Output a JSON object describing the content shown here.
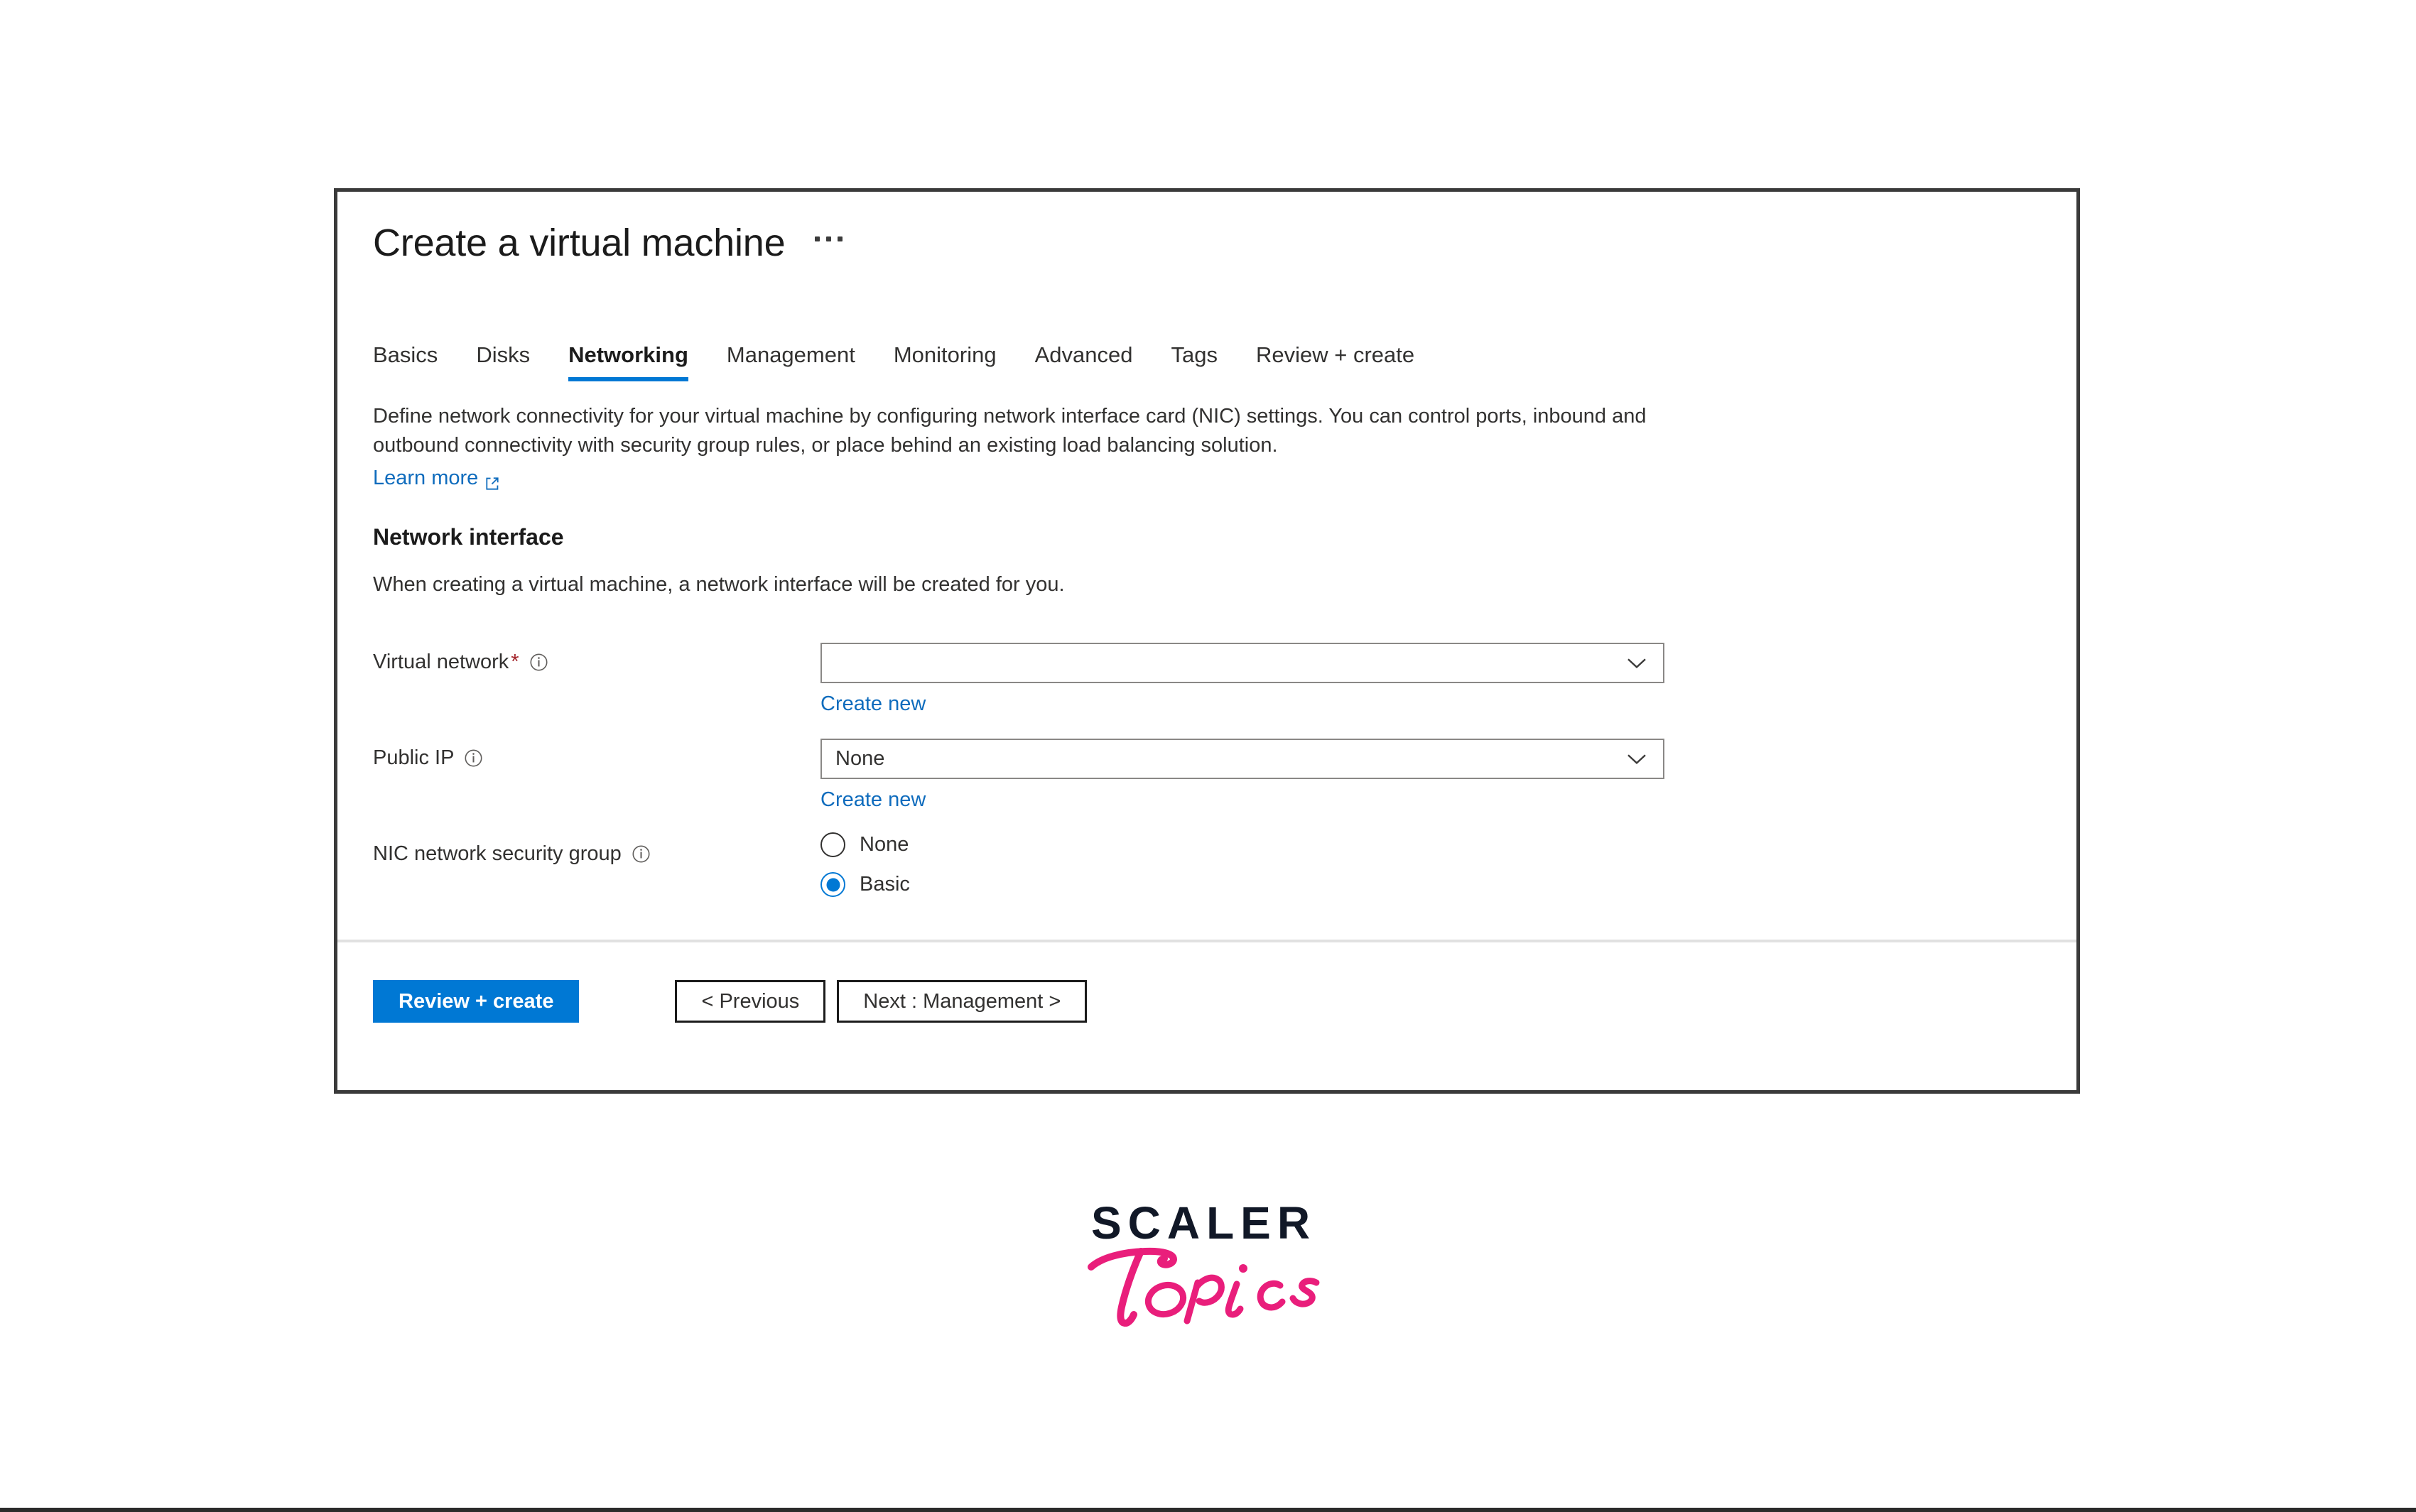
{
  "blade": {
    "title": "Create a virtual machine",
    "more_menu": "…",
    "tabs": [
      {
        "label": "Basics",
        "active": false
      },
      {
        "label": "Disks",
        "active": false
      },
      {
        "label": "Networking",
        "active": true
      },
      {
        "label": "Management",
        "active": false
      },
      {
        "label": "Monitoring",
        "active": false
      },
      {
        "label": "Advanced",
        "active": false
      },
      {
        "label": "Tags",
        "active": false
      },
      {
        "label": "Review + create",
        "active": false
      }
    ],
    "description": "Define network connectivity for your virtual machine by configuring network interface card (NIC) settings. You can control ports, inbound and outbound connectivity with security group rules, or place behind an existing load balancing solution.",
    "learn_more": "Learn more",
    "section": {
      "heading": "Network interface",
      "subtext": "When creating a virtual machine, a network interface will be created for you."
    },
    "fields": {
      "virtual_network": {
        "label": "Virtual network",
        "required_marker": "*",
        "value": "",
        "placeholder": "",
        "create_new": "Create new"
      },
      "public_ip": {
        "label": "Public IP",
        "value": "None",
        "create_new": "Create new"
      },
      "nic_security_group": {
        "label": "NIC network security group",
        "options": [
          {
            "label": "None",
            "selected": false
          },
          {
            "label": "Basic",
            "selected": true
          }
        ]
      }
    },
    "footer": {
      "review_create": "Review + create",
      "previous": "< Previous",
      "next": "Next : Management >"
    }
  },
  "logo": {
    "primary": "SCALER",
    "script": "Topics"
  },
  "colors": {
    "accent_blue": "#0078d4",
    "link_blue": "#0f6cbd",
    "required_red": "#a4262c",
    "logo_navy": "#111827",
    "logo_pink": "#e91e7b",
    "panel_border": "#3a3a3a",
    "field_border": "#8a8886"
  }
}
